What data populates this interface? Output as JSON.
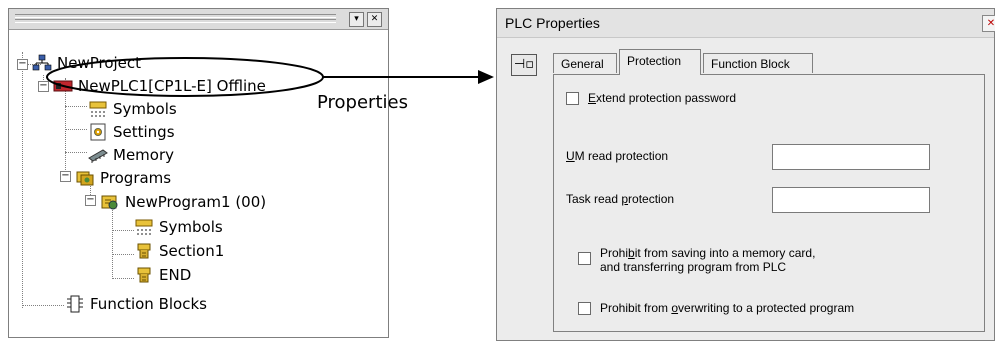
{
  "tree": {
    "items": [
      {
        "id": "project",
        "label": "NewProject",
        "icon": "network-icon"
      },
      {
        "id": "plc",
        "label": "NewPLC1[CP1L-E] Offline",
        "icon": "plc-icon"
      },
      {
        "id": "symbols",
        "label": "Symbols",
        "icon": "symbols-icon"
      },
      {
        "id": "settings",
        "label": "Settings",
        "icon": "settings-icon"
      },
      {
        "id": "memory",
        "label": "Memory",
        "icon": "memory-icon"
      },
      {
        "id": "programs",
        "label": "Programs",
        "icon": "programs-icon"
      },
      {
        "id": "program1",
        "label": "NewProgram1 (00)",
        "icon": "program-icon"
      },
      {
        "id": "prog-symbols",
        "label": "Symbols",
        "icon": "symbols-icon"
      },
      {
        "id": "section1",
        "label": "Section1",
        "icon": "section-icon"
      },
      {
        "id": "end",
        "label": "END",
        "icon": "section-icon"
      },
      {
        "id": "fb",
        "label": "Function Blocks",
        "icon": "function-block-icon"
      }
    ]
  },
  "callout": {
    "label": "Properties"
  },
  "props": {
    "title": "PLC Properties",
    "tabs": [
      "General",
      "Protection",
      "Function Block"
    ],
    "active_tab": "Protection",
    "extend_password": {
      "pre": "",
      "key": "E",
      "post": "xtend protection password",
      "checked": false
    },
    "um_read": {
      "pre": "",
      "key": "U",
      "post": "M read protection",
      "value": ""
    },
    "task_read": {
      "pre": "Task read ",
      "key": "p",
      "post": "rotection",
      "value": ""
    },
    "prohibit_saving": {
      "pre": "Prohi",
      "key": "b",
      "post": "it from saving into a memory card,",
      "line2": "and transferring program from PLC",
      "checked": false
    },
    "prohibit_overwrite": {
      "pre": "Prohibit from ",
      "key": "o",
      "post": "verwriting to a protected program",
      "checked": false
    }
  }
}
